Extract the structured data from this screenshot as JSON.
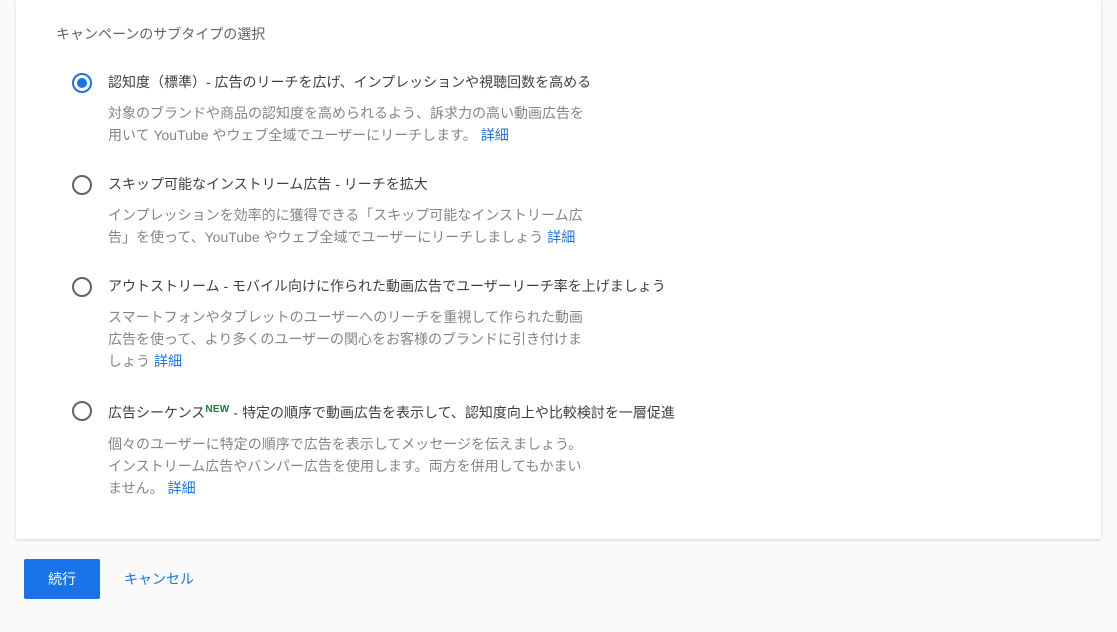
{
  "section_title": "キャンペーンのサブタイプの選択",
  "link_label": "詳細",
  "new_badge": "NEW",
  "options": [
    {
      "selected": true,
      "title": "認知度（標準）- 広告のリーチを広げ、インプレッションや視聴回数を高める",
      "desc": "対象のブランドや商品の認知度を高められるよう、訴求力の高い動画広告を用いて YouTube やウェブ全域でユーザーにリーチします。"
    },
    {
      "selected": false,
      "title": "スキップ可能なインストリーム広告 - リーチを拡大",
      "desc": "インプレッションを効率的に獲得できる「スキップ可能なインストリーム広告」を使って、YouTube やウェブ全域でユーザーにリーチしましょう"
    },
    {
      "selected": false,
      "title": "アウトストリーム - モバイル向けに作られた動画広告でユーザーリーチ率を上げましょう",
      "desc": "スマートフォンやタブレットのユーザーへのリーチを重視して作られた動画広告を使って、より多くのユーザーの関心をお客様のブランドに引き付けましょう"
    },
    {
      "selected": false,
      "title_pre": "広告シーケンス",
      "title_post": " - 特定の順序で動画広告を表示して、認知度向上や比較検討を一層促進",
      "desc": "個々のユーザーに特定の順序で広告を表示してメッセージを伝えましょう。インストリーム広告やバンパー広告を使用します。両方を併用してもかまいません。",
      "has_badge": true
    }
  ],
  "footer": {
    "continue": "続行",
    "cancel": "キャンセル"
  }
}
